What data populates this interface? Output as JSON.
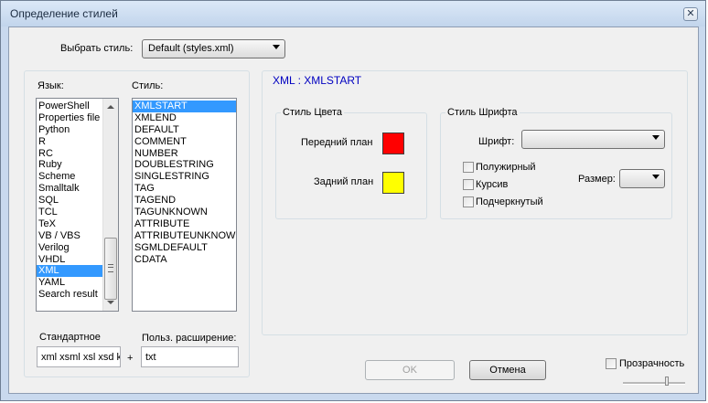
{
  "window": {
    "title": "Определение стилей",
    "close_glyph": "✕"
  },
  "style_select": {
    "label": "Выбрать стиль:",
    "value": "Default (styles.xml)"
  },
  "languages": {
    "label": "Язык:",
    "items": [
      "PowerShell",
      "Properties file",
      "Python",
      "R",
      "RC",
      "Ruby",
      "Scheme",
      "Smalltalk",
      "SQL",
      "TCL",
      "TeX",
      "VB / VBS",
      "Verilog",
      "VHDL",
      "XML",
      "YAML",
      "Search result"
    ],
    "selected": "XML"
  },
  "styles": {
    "label": "Стиль:",
    "items": [
      "XMLSTART",
      "XMLEND",
      "DEFAULT",
      "COMMENT",
      "NUMBER",
      "DOUBLESTRING",
      "SINGLESTRING",
      "TAG",
      "TAGEND",
      "TAGUNKNOWN",
      "ATTRIBUTE",
      "ATTRIBUTEUNKNOWN",
      "SGMLDEFAULT",
      "CDATA"
    ],
    "selected": "XMLSTART"
  },
  "extensions": {
    "default_label": "Стандартное",
    "default_value": "xml xsml xsl xsd k",
    "plus": "+",
    "user_label": "Польз. расширение:",
    "user_value": "txt"
  },
  "style_panel": {
    "heading": "XML : XMLSTART",
    "heading_color": "#0000c0",
    "color_group": {
      "label": "Стиль Цвета",
      "foreground_label": "Передний план",
      "foreground_color": "#ff0000",
      "background_label": "Задний план",
      "background_color": "#ffff00"
    },
    "font_group": {
      "label": "Стиль Шрифта",
      "font_label": "Шрифт:",
      "font_value": "",
      "bold_label": "Полужирный",
      "italic_label": "Курсив",
      "underline_label": "Подчеркнутый",
      "size_label": "Размер:",
      "size_value": ""
    }
  },
  "buttons": {
    "ok": "OK",
    "cancel": "Отмена"
  },
  "transparency": {
    "label": "Прозрачность"
  }
}
